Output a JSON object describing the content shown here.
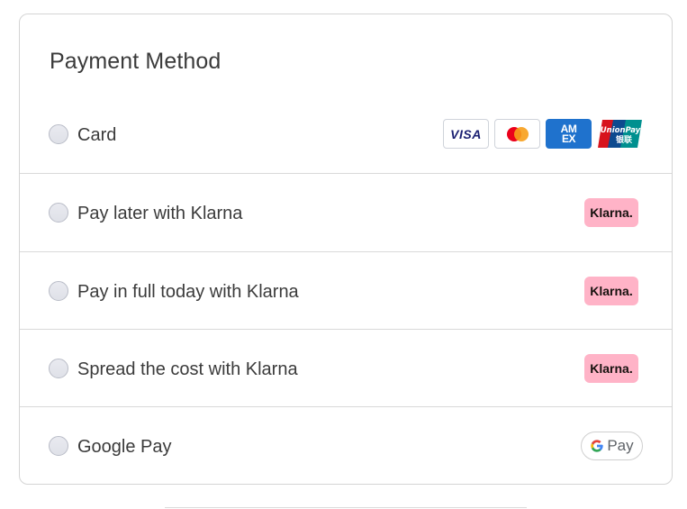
{
  "payment": {
    "title": "Payment Method",
    "methods": [
      {
        "label": "Card",
        "badges": [
          "visa-icon",
          "mastercard-icon",
          "amex-icon",
          "unionpay-icon"
        ]
      },
      {
        "label": "Pay later with Klarna",
        "badge_text": "Klarna."
      },
      {
        "label": "Pay in full today with Klarna",
        "badge_text": "Klarna."
      },
      {
        "label": "Spread the cost with Klarna",
        "badge_text": "Klarna."
      },
      {
        "label": "Google Pay",
        "badge_text": "Pay"
      }
    ]
  },
  "badges": {
    "visa": "VISA",
    "amex_top": "AM",
    "amex_bottom": "EX",
    "unionpay": "UnionPay",
    "unionpay_cn": "银联"
  },
  "colors": {
    "klarna_pink": "#ffb3c7",
    "visa_blue": "#1a1f71",
    "amex_blue": "#1f72cd",
    "mastercard_red": "#eb001b",
    "mastercard_orange": "#f79e1b",
    "border": "#d4d4d4"
  }
}
